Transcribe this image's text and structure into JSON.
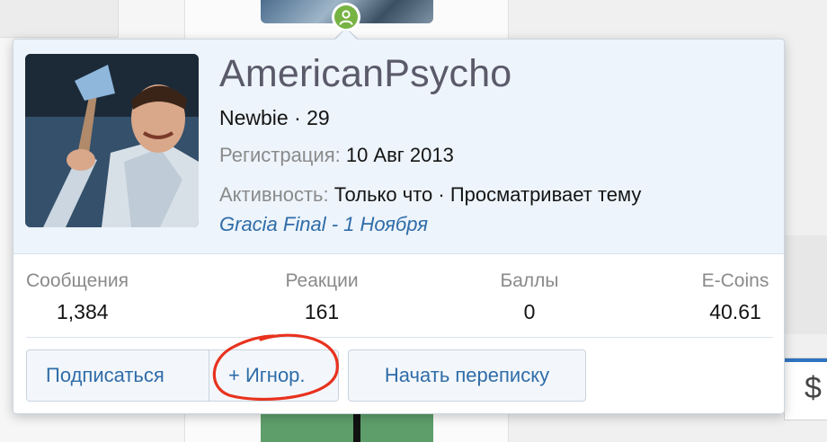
{
  "profile": {
    "username": "AmericanPsycho",
    "title_line": "Newbie · 29",
    "registration_label": "Регистрация:",
    "registration_value": "10 Авг 2013",
    "activity_label": "Активность:",
    "activity_value": "Только что · Просматривает тему",
    "activity_link": "Gracia Final - 1 Ноября"
  },
  "stats": [
    {
      "label": "Сообщения",
      "value": "1,384"
    },
    {
      "label": "Реакции",
      "value": "161"
    },
    {
      "label": "Баллы",
      "value": "0"
    },
    {
      "label": "E-Coins",
      "value": "40.61"
    }
  ],
  "buttons": {
    "follow": "Подписаться",
    "ignore": "+ Игнор.",
    "message": "Начать переписку"
  },
  "colors": {
    "accent_link": "#2f6ca8",
    "header_bg": "#edf4fb",
    "online_badge": "#77b343",
    "annotation": "#e8321e"
  },
  "icons": {
    "online_badge": "user-icon",
    "background_glyph": "dollar-icon"
  }
}
